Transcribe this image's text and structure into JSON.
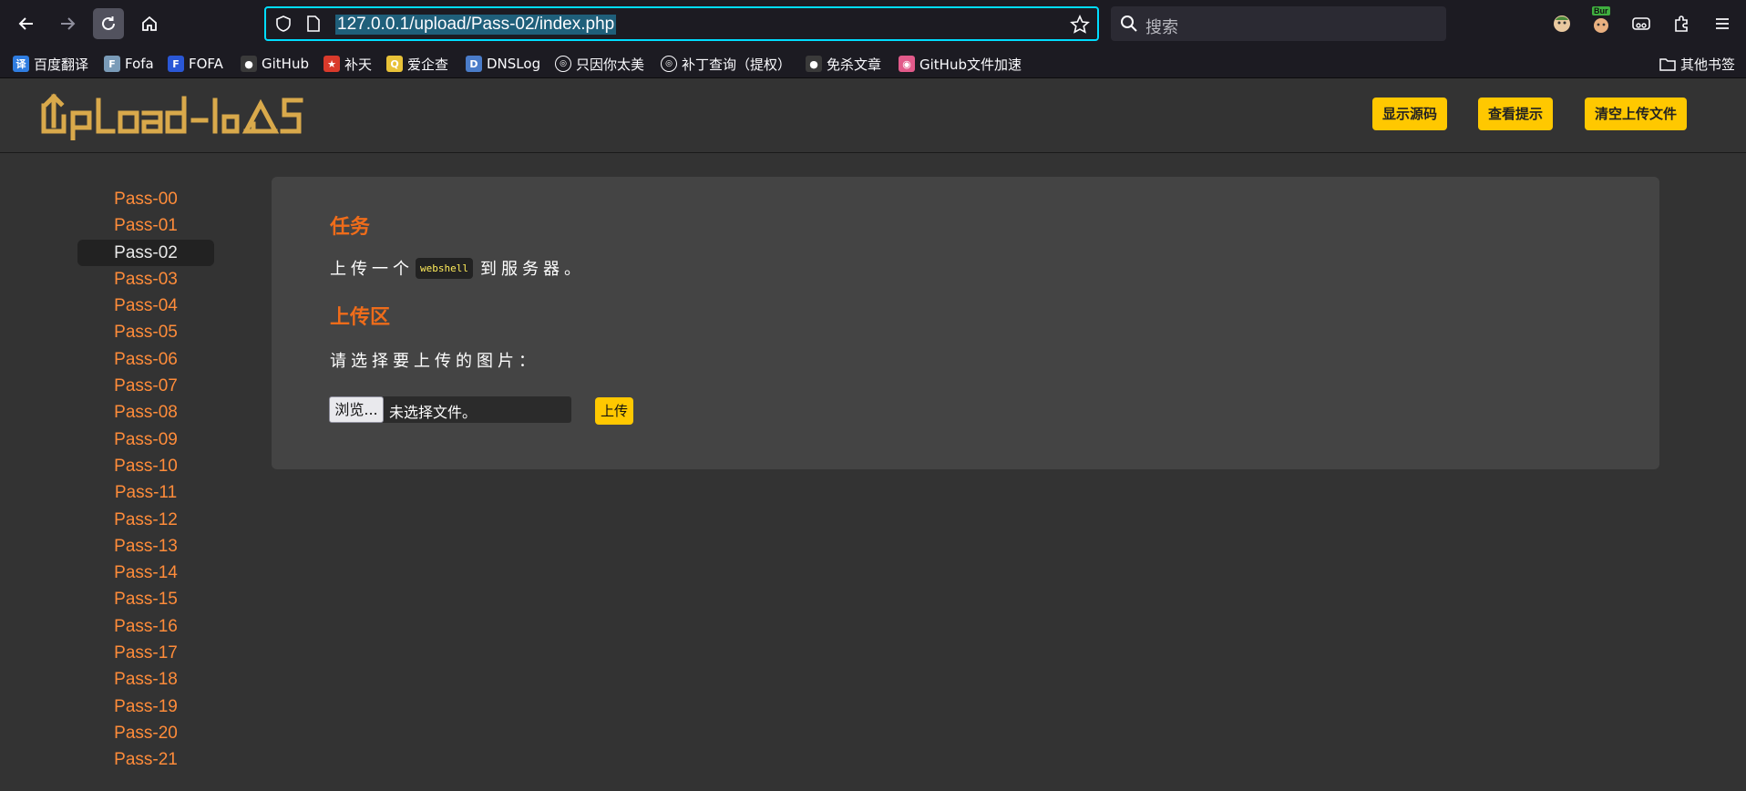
{
  "browser": {
    "url": "127.0.0.1/upload/Pass-02/index.php",
    "search_placeholder": "搜索",
    "ext_badge": "Bur"
  },
  "bookmarks": [
    {
      "label": "百度翻译",
      "icon": "translate-icon",
      "glyph": "译",
      "color": "#2f7de1"
    },
    {
      "label": "Fofa",
      "icon": "fofa-icon",
      "glyph": "F",
      "color": "#7a9bb8"
    },
    {
      "label": "FOFA",
      "icon": "fofa-shield-icon",
      "glyph": "F",
      "color": "#2a57d6"
    },
    {
      "label": "GitHub",
      "icon": "github-icon",
      "glyph": "●",
      "color": "#3a3a3a"
    },
    {
      "label": "补天",
      "icon": "butian-icon",
      "glyph": "★",
      "color": "#d93a2b"
    },
    {
      "label": "爱企查",
      "icon": "aiqicha-icon",
      "glyph": "Q",
      "color": "#e8c238"
    },
    {
      "label": "DNSLog",
      "icon": "dnslog-icon",
      "glyph": "D",
      "color": "#4a7cc9"
    },
    {
      "label": "只因你太美",
      "icon": "globe-icon",
      "glyph": "◎",
      "color": "#1c1b22"
    },
    {
      "label": "补丁查询（提权）",
      "icon": "globe-icon",
      "glyph": "◎",
      "color": "#1c1b22"
    },
    {
      "label": "免杀文章",
      "icon": "github-icon",
      "glyph": "●",
      "color": "#3a3a3a"
    },
    {
      "label": "GitHub文件加速",
      "icon": "pig-icon",
      "glyph": "◉",
      "color": "#e25a8a"
    }
  ],
  "other_bookmarks": "其他书签",
  "header": {
    "logo_text": "UpLoad-labs",
    "buttons": [
      "显示源码",
      "查看提示",
      "清空上传文件"
    ]
  },
  "sidebar": {
    "active": "Pass-02",
    "items": [
      "Pass-00",
      "Pass-01",
      "Pass-02",
      "Pass-03",
      "Pass-04",
      "Pass-05",
      "Pass-06",
      "Pass-07",
      "Pass-08",
      "Pass-09",
      "Pass-10",
      "Pass-11",
      "Pass-12",
      "Pass-13",
      "Pass-14",
      "Pass-15",
      "Pass-16",
      "Pass-17",
      "Pass-18",
      "Pass-19",
      "Pass-20",
      "Pass-21"
    ]
  },
  "main": {
    "task_title": "任务",
    "task_prefix": "上传一个",
    "task_code": "webshell",
    "task_suffix": "到服务器。",
    "upload_title": "上传区",
    "upload_prompt": "请选择要上传的图片：",
    "browse_label": "浏览...",
    "file_status": "未选择文件。",
    "submit_label": "上传"
  },
  "colors": {
    "accent_button": "#ffc800",
    "heading": "#ef6c1a",
    "sidebar_link": "#ff8c3a",
    "url_focus": "#00ddff"
  }
}
